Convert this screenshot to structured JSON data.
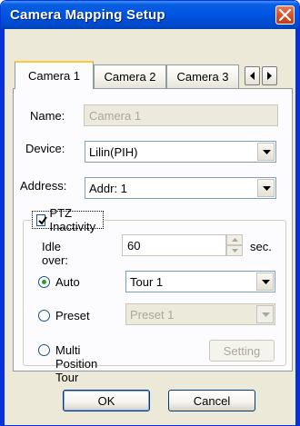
{
  "window": {
    "title": "Camera Mapping Setup"
  },
  "tabs": [
    {
      "label": "Camera 1",
      "active": true
    },
    {
      "label": "Camera 2",
      "active": false
    },
    {
      "label": "Camera 3",
      "active": false
    }
  ],
  "form": {
    "name_label": "Name:",
    "name_value": "Camera 1",
    "device_label": "Device:",
    "device_value": "Lilin(PIH)",
    "address_label": "Address:",
    "address_value": "Addr: 1"
  },
  "ptz": {
    "group_label": "PTZ Inactivity",
    "enabled": true,
    "idle_label": "Idle over:",
    "idle_value": "60",
    "idle_unit": "sec.",
    "auto_label": "Auto",
    "auto_value": "Tour 1",
    "preset_label": "Preset",
    "preset_value": "Preset 1",
    "multi_label": "Multi Position Tour",
    "setting_label": "Setting",
    "selected_mode": "Auto"
  },
  "buttons": {
    "ok_label": "OK",
    "cancel_label": "Cancel"
  },
  "colors": {
    "titlebar": "#0054e3",
    "close": "#d8512b",
    "dialog_bg": "#ece9d8",
    "tab_highlight": "#ffc83c"
  }
}
